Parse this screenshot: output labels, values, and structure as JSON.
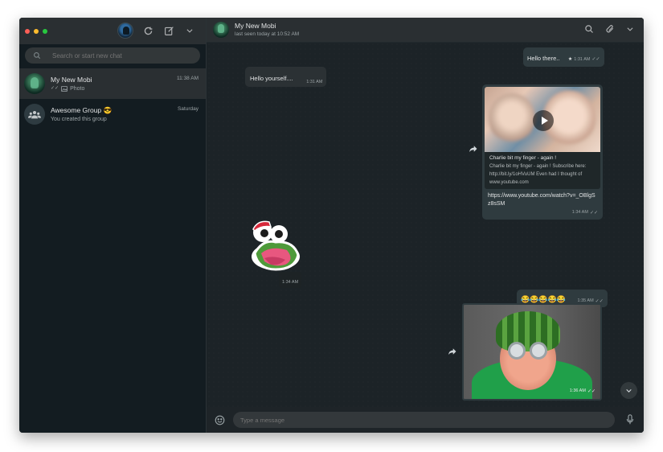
{
  "colors": {
    "accent": "#00bfa5",
    "panel": "#2a2f32",
    "bubble_out": "#2f3b3f",
    "bubble_in": "#2b3134"
  },
  "sidebar": {
    "search": {
      "placeholder": "Search or start new chat"
    },
    "chats": [
      {
        "name": "My New Mobi",
        "subtitle": "Photo",
        "time": "11:38 AM",
        "active": true,
        "icon": "photo-icon"
      },
      {
        "name": "Awesome Group 😎",
        "subtitle": "You created this group",
        "time": "Saturday",
        "active": false,
        "icon": "group-icon"
      }
    ]
  },
  "header": {
    "contact_name": "My New Mobi",
    "status": "last seen today at 10:52 AM",
    "icons": [
      "search-icon",
      "attach-icon",
      "chevron-down-icon"
    ]
  },
  "messages": [
    {
      "type": "text",
      "direction": "out",
      "text": "Hello there..",
      "time": "1:31 AM",
      "starred": true
    },
    {
      "type": "text",
      "direction": "in",
      "text": "Hello yourself....",
      "time": "1:31 AM"
    },
    {
      "type": "link",
      "direction": "out",
      "card_title": "Charlie bit my finger - again !",
      "card_desc": "Charlie bit my finger - again ! Subscribe here: http://bit.ly/1oHVuUM Even had I thought of www.youtube.com",
      "url": "https://www.youtube.com/watch?v=_OBlgSz8sSM",
      "time": "1:34 AM"
    },
    {
      "type": "sticker",
      "direction": "in",
      "time": "1:34 AM"
    },
    {
      "type": "text",
      "direction": "out",
      "text": "😂😂😂😂😂",
      "time": "1:35 AM"
    },
    {
      "type": "image",
      "direction": "out",
      "time": "1:36 AM"
    }
  ],
  "composer": {
    "placeholder": "Type a message"
  }
}
